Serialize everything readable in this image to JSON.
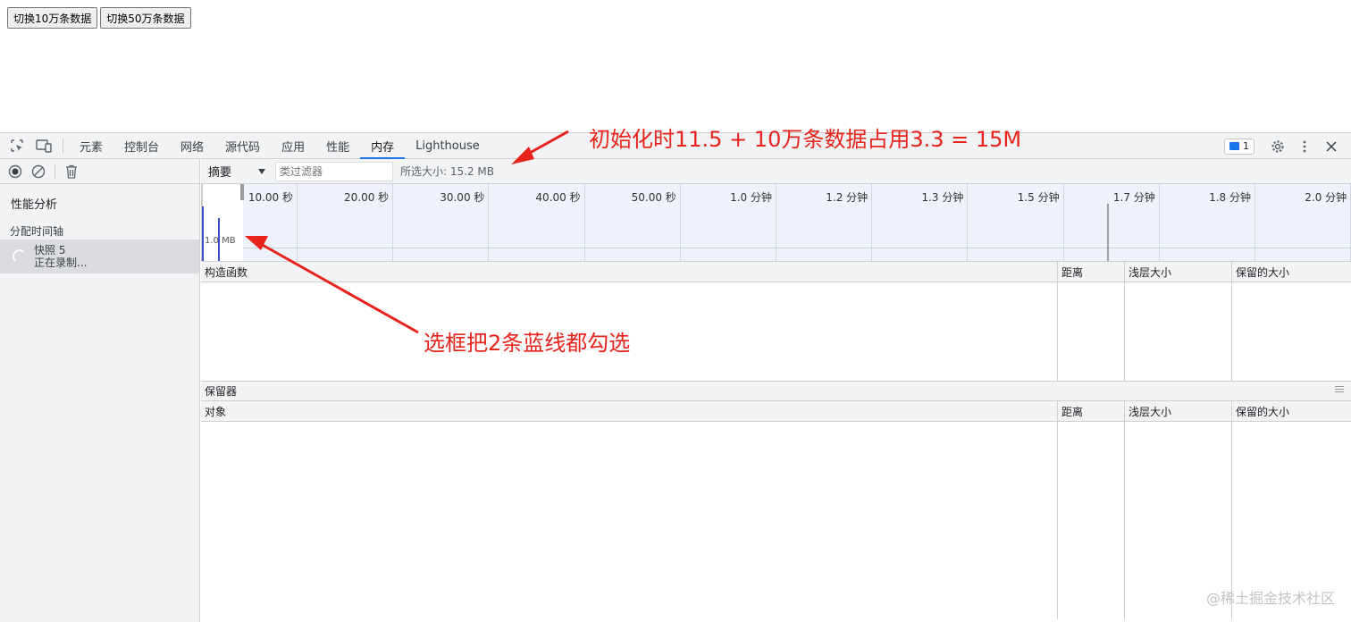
{
  "page": {
    "buttons": [
      "切换10万条数据",
      "切换50万条数据"
    ]
  },
  "devtools": {
    "tabs": [
      "元素",
      "控制台",
      "网络",
      "源代码",
      "应用",
      "性能",
      "内存",
      "Lighthouse"
    ],
    "active_tab": "内存",
    "issues_count": "1",
    "left": {
      "heading": "性能分析",
      "group": "分配时间轴",
      "snapshot_name": "快照 5",
      "snapshot_status": "正在录制..."
    },
    "filter": {
      "view": "摘要",
      "class_filter_placeholder": "类过滤器",
      "selected_size": "所选大小:  15.2 MB"
    },
    "timeline": {
      "ticks": [
        "10.00 秒",
        "20.00 秒",
        "30.00 秒",
        "40.00 秒",
        "50.00 秒",
        "1.0 分钟",
        "1.2 分钟",
        "1.3 分钟",
        "1.5 分钟",
        "1.7 分钟",
        "1.8 分钟",
        "2.0 分钟"
      ],
      "mem_label": "1.0 MB"
    },
    "constructors_table": {
      "columns": [
        "构造函数",
        "距离",
        "浅层大小",
        "保留的大小"
      ]
    },
    "retainers": {
      "title": "保留器",
      "columns": [
        "对象",
        "距离",
        "浅层大小",
        "保留的大小"
      ]
    }
  },
  "annotations": {
    "top": "初始化时11.5 + 10万条数据占用3.3 = 15M",
    "middle": "选框把2条蓝线都勾选"
  },
  "watermark": "@稀土掘金技术社区",
  "colors": {
    "annotation": "#e8231b",
    "accent": "#1a73e8",
    "bar": "#3c4fc9"
  }
}
